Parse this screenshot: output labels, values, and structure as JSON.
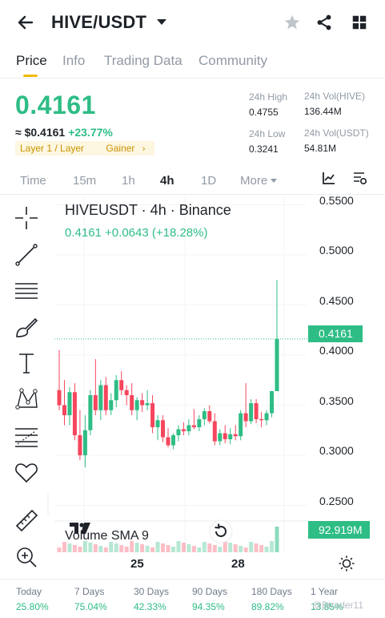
{
  "header": {
    "pair": "HIVE/USDT"
  },
  "tabs": [
    "Price",
    "Info",
    "Trading Data",
    "Community"
  ],
  "price": {
    "last": "0.4161",
    "usd": "≈ $0.4161",
    "change": "+23.77%",
    "tags": [
      "Layer 1 / Layer",
      "Gainer"
    ],
    "stats": {
      "high_label": "24h High",
      "high_value": "0.4755",
      "low_label": "24h Low",
      "low_value": "0.3241",
      "vol_base_label": "24h Vol(HIVE)",
      "vol_base_value": "136.44M",
      "vol_quote_label": "24h Vol(USDT)",
      "vol_quote_value": "54.81M"
    }
  },
  "intervals": [
    "Time",
    "15m",
    "1h",
    "4h",
    "1D",
    "More"
  ],
  "chart": {
    "title": "HIVEUSDT · 4h · Binance",
    "ohlc": "0.4161  +0.0643 (+18.28%)",
    "y_ticks": [
      "0.5500",
      "0.5000",
      "0.4500",
      "0.4000",
      "0.3500",
      "0.3000",
      "0.2500"
    ],
    "price_tag": "0.4161",
    "volume_label": "Volume SMA 9",
    "volume_tag": "92.919M",
    "x_ticks": [
      "25",
      "28"
    ],
    "colors": {
      "up": "#2ebd85",
      "down": "#f6465d",
      "accent": "#f0b90b"
    }
  },
  "chart_data": {
    "type": "candlestick",
    "title": "HIVEUSDT · 4h · Binance",
    "ylim": [
      0.23,
      0.56
    ],
    "y_ticks": [
      0.55,
      0.5,
      0.45,
      0.4,
      0.35,
      0.3,
      0.25
    ],
    "x_ticks": [
      "25",
      "28"
    ],
    "last_price": 0.4161,
    "candles": [
      [
        0.365,
        0.405,
        0.345,
        0.35
      ],
      [
        0.35,
        0.375,
        0.33,
        0.34
      ],
      [
        0.34,
        0.368,
        0.33,
        0.363
      ],
      [
        0.363,
        0.372,
        0.315,
        0.32
      ],
      [
        0.32,
        0.345,
        0.295,
        0.3
      ],
      [
        0.3,
        0.34,
        0.288,
        0.325
      ],
      [
        0.325,
        0.365,
        0.32,
        0.36
      ],
      [
        0.36,
        0.396,
        0.34,
        0.345
      ],
      [
        0.345,
        0.375,
        0.335,
        0.37
      ],
      [
        0.37,
        0.378,
        0.34,
        0.345
      ],
      [
        0.345,
        0.362,
        0.34,
        0.355
      ],
      [
        0.355,
        0.38,
        0.348,
        0.375
      ],
      [
        0.375,
        0.384,
        0.36,
        0.365
      ],
      [
        0.365,
        0.37,
        0.35,
        0.36
      ],
      [
        0.36,
        0.372,
        0.34,
        0.345
      ],
      [
        0.345,
        0.358,
        0.335,
        0.355
      ],
      [
        0.355,
        0.362,
        0.343,
        0.35
      ],
      [
        0.35,
        0.365,
        0.345,
        0.352
      ],
      [
        0.352,
        0.36,
        0.322,
        0.328
      ],
      [
        0.328,
        0.34,
        0.315,
        0.335
      ],
      [
        0.335,
        0.34,
        0.313,
        0.318
      ],
      [
        0.318,
        0.327,
        0.308,
        0.31
      ],
      [
        0.31,
        0.322,
        0.306,
        0.32
      ],
      [
        0.32,
        0.33,
        0.314,
        0.326
      ],
      [
        0.326,
        0.333,
        0.32,
        0.324
      ],
      [
        0.324,
        0.336,
        0.32,
        0.33
      ],
      [
        0.33,
        0.346,
        0.326,
        0.328
      ],
      [
        0.328,
        0.34,
        0.324,
        0.336
      ],
      [
        0.336,
        0.347,
        0.33,
        0.344
      ],
      [
        0.344,
        0.35,
        0.332,
        0.334
      ],
      [
        0.334,
        0.342,
        0.31,
        0.314
      ],
      [
        0.314,
        0.326,
        0.31,
        0.322
      ],
      [
        0.322,
        0.33,
        0.312,
        0.316
      ],
      [
        0.316,
        0.327,
        0.311,
        0.321
      ],
      [
        0.321,
        0.33,
        0.315,
        0.319
      ],
      [
        0.319,
        0.345,
        0.315,
        0.342
      ],
      [
        0.342,
        0.372,
        0.328,
        0.334
      ],
      [
        0.334,
        0.356,
        0.331,
        0.352
      ],
      [
        0.352,
        0.356,
        0.332,
        0.336
      ],
      [
        0.336,
        0.343,
        0.328,
        0.335
      ],
      [
        0.335,
        0.345,
        0.33,
        0.342
      ],
      [
        0.342,
        0.364,
        0.338,
        0.364
      ],
      [
        0.364,
        0.475,
        0.364,
        0.4161
      ]
    ],
    "volume_last": "92.919M"
  },
  "performance": [
    {
      "label": "Today",
      "value": "25.80%"
    },
    {
      "label": "7 Days",
      "value": "75.04%"
    },
    {
      "label": "30 Days",
      "value": "42.33%"
    },
    {
      "label": "90 Days",
      "value": "94.35%"
    },
    {
      "label": "180 Days",
      "value": "89.82%"
    },
    {
      "label": "1 Year",
      "value": "13.85%"
    }
  ],
  "watermark": "@Btrader11"
}
